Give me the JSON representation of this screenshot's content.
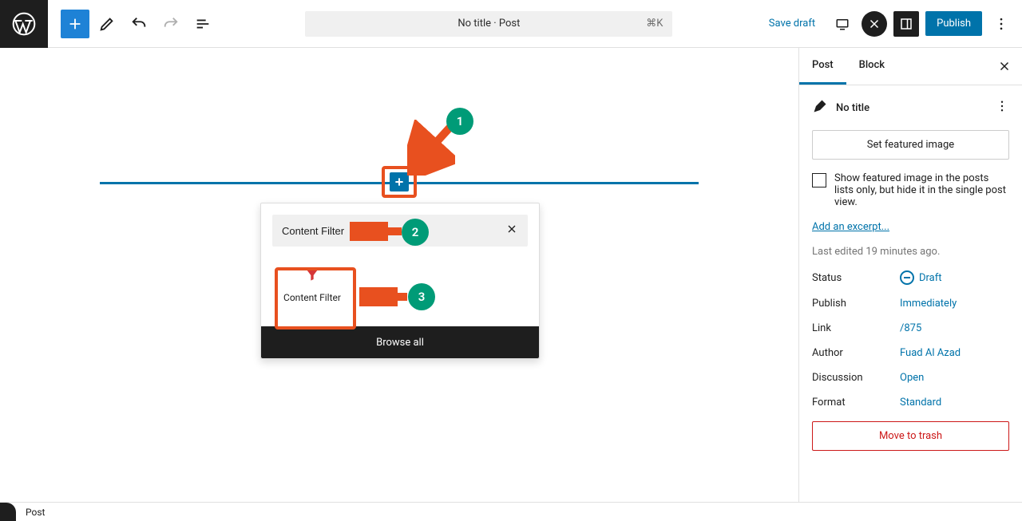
{
  "header": {
    "doc_title": "No title · Post",
    "shortcut": "⌘K",
    "save_draft": "Save draft",
    "publish": "Publish"
  },
  "inserter": {
    "search_value": "Content Filter",
    "block_name": "Content Filter",
    "browse_all": "Browse all"
  },
  "sidebar": {
    "tabs": {
      "post": "Post",
      "block": "Block"
    },
    "title": "No title",
    "set_featured": "Set featured image",
    "featured_checkbox": "Show featured image in the posts lists only, but hide it in the single post view.",
    "add_excerpt": "Add an excerpt...",
    "last_edited": "Last edited 19 minutes ago.",
    "meta": {
      "status_label": "Status",
      "status_value": "Draft",
      "publish_label": "Publish",
      "publish_value": "Immediately",
      "link_label": "Link",
      "link_value": "/875",
      "author_label": "Author",
      "author_value": "Fuad Al Azad",
      "discussion_label": "Discussion",
      "discussion_value": "Open",
      "format_label": "Format",
      "format_value": "Standard"
    },
    "trash": "Move to trash"
  },
  "footer": {
    "breadcrumb": "Post"
  },
  "annot": {
    "n1": "1",
    "n2": "2",
    "n3": "3"
  }
}
